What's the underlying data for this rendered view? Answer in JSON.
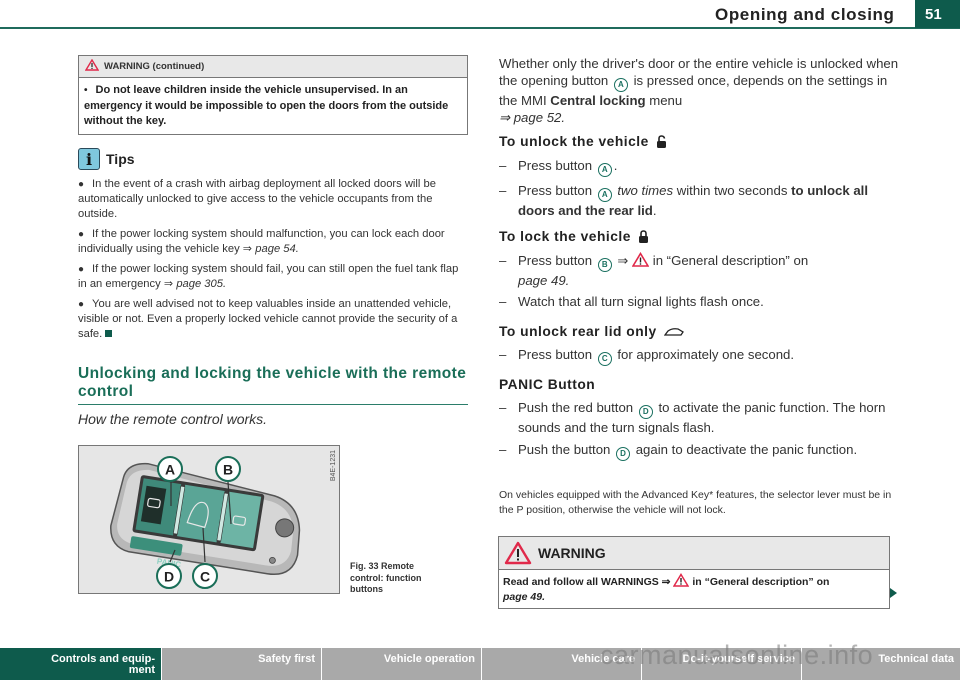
{
  "header": {
    "section_title": "Opening and closing",
    "page_number": "51"
  },
  "left": {
    "warning_continued": {
      "title": "WARNING (continued)",
      "bullet": "•",
      "text": "Do not leave children inside the vehicle unsupervised. In an emergency it would be impossible to open the doors from the outside without the key."
    },
    "tips": {
      "icon_glyph": "i",
      "title": "Tips",
      "items": [
        {
          "text": "In the event of a crash with airbag deployment all locked doors will be automatically unlocked to give access to the vehicle occupants from the outside.",
          "ref": ""
        },
        {
          "text": "If the power locking system should malfunction, you can lock each door individually using the vehicle key ⇒ ",
          "ref": "page 54."
        },
        {
          "text": "If the power locking system should fail, you can still open the fuel tank flap in an emergency ⇒ ",
          "ref": "page 305."
        },
        {
          "text": "You are well advised not to keep valuables inside an unattended vehicle, visible or not. Even a properly locked vehicle cannot provide the security of a safe.",
          "ref": ""
        }
      ]
    },
    "section_heading": "Unlocking and locking the vehicle with the remote control",
    "section_subtitle": "How the remote control works.",
    "figure": {
      "code": "B4E-1231",
      "labels": [
        "A",
        "B",
        "C",
        "D"
      ],
      "panic_label": "PANIC",
      "caption": "Fig. 33  Remote control: function buttons"
    }
  },
  "right": {
    "intro": {
      "pre": "Whether only the driver's door or the entire vehicle is unlocked when the opening button ",
      "btn": "A",
      "mid": " is pressed once, depends on the settings in the MMI ",
      "bold": "Central locking",
      "post": " menu ",
      "ref": "⇒ page 52."
    },
    "unlock": {
      "title": "To unlock the vehicle",
      "steps": [
        {
          "pre": "Press button ",
          "btn": "A",
          "post": "."
        },
        {
          "pre": "Press button ",
          "btn": "A",
          "italic": " two times",
          "mid": " within two seconds ",
          "bold": "to unlock all doors and the rear lid",
          "post": "."
        }
      ]
    },
    "lock": {
      "title": "To lock the vehicle",
      "steps": [
        {
          "pre": "Press button ",
          "btn": "B",
          "mid": " ⇒ ",
          "post": " in “General description” on ",
          "ref": "page 49."
        },
        {
          "text": "Watch that all turn signal lights flash once."
        }
      ]
    },
    "rear_lid": {
      "title": "To unlock rear lid only",
      "steps": [
        {
          "pre": "Press button ",
          "btn": "C",
          "post": " for approximately one second."
        }
      ]
    },
    "panic": {
      "title": "PANIC Button",
      "steps": [
        {
          "pre": "Push the red button ",
          "btn": "D",
          "post": " to activate the panic function. The horn sounds and the turn signals flash."
        },
        {
          "pre": "Push the button ",
          "btn": "D",
          "post": " again to deactivate the panic function."
        }
      ]
    },
    "note": "On vehicles equipped with the Advanced Key* features, the selector lever must be in the P position, otherwise the vehicle will not lock.",
    "warning": {
      "title": "WARNING",
      "pre": "Read and follow all WARNINGS ⇒ ",
      "post": " in “General description” on ",
      "ref": "page 49."
    }
  },
  "footer": {
    "tabs": [
      {
        "label": "Controls and equip-\nment",
        "active": true
      },
      {
        "label": "Safety first",
        "active": false
      },
      {
        "label": "Vehicle operation",
        "active": false
      },
      {
        "label": "Vehicle care",
        "active": false
      },
      {
        "label": "Do-it-yourself service",
        "active": false
      },
      {
        "label": "Technical data",
        "active": false
      }
    ],
    "watermark": "carmanualsonline.info"
  },
  "colors": {
    "brand_green": "#0e5b4c",
    "heading_green": "#1a6e58",
    "warning_red": "#e0294a",
    "tab_gray": "#a9a9a9"
  }
}
